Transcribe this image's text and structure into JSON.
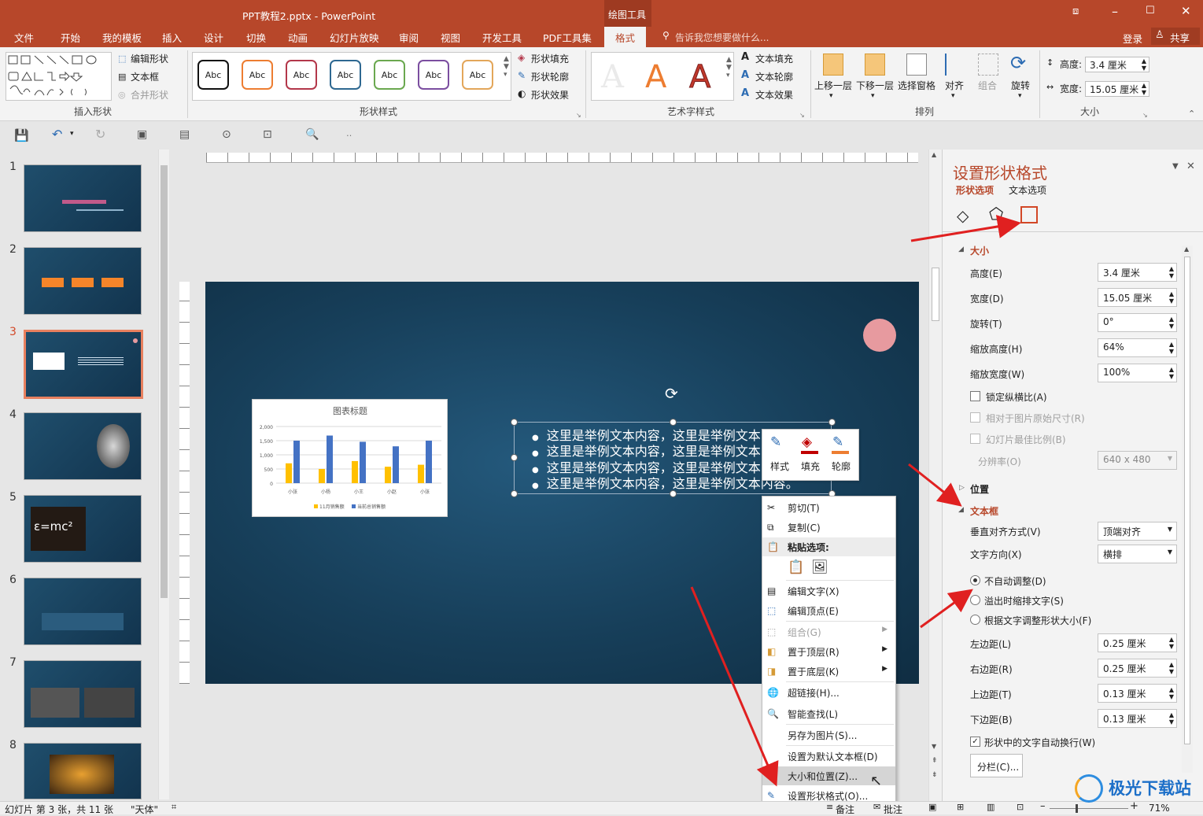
{
  "window": {
    "title": "PPT教程2.pptx - PowerPoint",
    "context_tab": "绘图工具"
  },
  "tabs": [
    "文件",
    "开始",
    "我的模板",
    "插入",
    "设计",
    "切换",
    "动画",
    "幻灯片放映",
    "审阅",
    "视图",
    "开发工具",
    "PDF工具集",
    "格式"
  ],
  "tell_me": "告诉我您想要做什么...",
  "account": {
    "login": "登录",
    "share": "共享"
  },
  "ribbon": {
    "insert_shapes": {
      "edit_shape": "编辑形状",
      "text_box": "文本框",
      "merge_shapes": "合并形状",
      "label": "插入形状"
    },
    "shape_styles": {
      "sample": "Abc",
      "fill": "形状填充",
      "outline": "形状轮廓",
      "effects": "形状效果",
      "label": "形状样式"
    },
    "wordart": {
      "text_fill": "文本填充",
      "text_outline": "文本轮廓",
      "text_effects": "文本效果",
      "label": "艺术字样式"
    },
    "arrange": {
      "bring_forward": "上移一层",
      "send_backward": "下移一层",
      "selection_pane": "选择窗格",
      "align": "对齐",
      "group": "组合",
      "rotate": "旋转",
      "label": "排列"
    },
    "size": {
      "height_label": "高度:",
      "height_value": "3.4 厘米",
      "width_label": "宽度:",
      "width_value": "15.05 厘米",
      "label": "大小"
    }
  },
  "slides": [
    "1",
    "2",
    "3",
    "4",
    "5",
    "6",
    "7",
    "8"
  ],
  "slide_content": {
    "chart_title": "图表标题",
    "bullets": [
      "这里是举例文本内容，这里是举例文本内容。",
      "这里是举例文本内容，这里是举例文本内容。",
      "这里是举例文本内容，这里是举例文本内容。",
      "这里是举例文本内容，这里是举例文本内容。"
    ]
  },
  "chart_data": {
    "type": "bar",
    "title": "图表标题",
    "categories": [
      "小张",
      "小杨",
      "小王",
      "小赵",
      "小张"
    ],
    "series": [
      {
        "name": "11月销售额",
        "color": "#ffc000",
        "values": [
          700,
          500,
          780,
          580,
          650
        ]
      },
      {
        "name": "当前总销售额",
        "color": "#4472c4",
        "values": [
          1500,
          1680,
          1460,
          1300,
          1500
        ]
      }
    ],
    "yticks": [
      "2,000",
      "1,500",
      "1,000",
      "500",
      "0"
    ],
    "ylim": [
      0,
      2000
    ]
  },
  "mini_toolbar": {
    "style": "样式",
    "fill": "填充",
    "outline": "轮廓"
  },
  "context_menu": {
    "cut": "剪切(T)",
    "copy": "复制(C)",
    "paste_options": "粘贴选项:",
    "edit_text": "编辑文字(X)",
    "edit_points": "编辑顶点(E)",
    "group": "组合(G)",
    "bring_to_front": "置于顶层(R)",
    "send_to_back": "置于底层(K)",
    "hyperlink": "超链接(H)...",
    "smart_lookup": "智能查找(L)",
    "save_as_picture": "另存为图片(S)...",
    "set_default": "设置为默认文本框(D)",
    "size_position": "大小和位置(Z)...",
    "format_shape": "设置形状格式(O)..."
  },
  "format_pane": {
    "title": "设置形状格式",
    "tab_shape": "形状选项",
    "tab_text": "文本选项",
    "size_section": "大小",
    "height": {
      "label": "高度(E)",
      "value": "3.4 厘米"
    },
    "width": {
      "label": "宽度(D)",
      "value": "15.05 厘米"
    },
    "rotation": {
      "label": "旋转(T)",
      "value": "0°"
    },
    "scale_height": {
      "label": "缩放高度(H)",
      "value": "64%"
    },
    "scale_width": {
      "label": "缩放宽度(W)",
      "value": "100%"
    },
    "lock_aspect": "锁定纵横比(A)",
    "relative_original": "相对于图片原始尺寸(R)",
    "best_scale": "幻灯片最佳比例(B)",
    "resolution": {
      "label": "分辨率(O)",
      "value": "640 x 480"
    },
    "position_section": "位置",
    "textbox_section": "文本框",
    "vertical_align": {
      "label": "垂直对齐方式(V)",
      "value": "顶端对齐"
    },
    "text_direction": {
      "label": "文字方向(X)",
      "value": "横排"
    },
    "autofit_none": "不自动调整(D)",
    "autofit_shrink": "溢出时缩排文字(S)",
    "autofit_resize": "根据文字调整形状大小(F)",
    "left_margin": {
      "label": "左边距(L)",
      "value": "0.25 厘米"
    },
    "right_margin": {
      "label": "右边距(R)",
      "value": "0.25 厘米"
    },
    "top_margin": {
      "label": "上边距(T)",
      "value": "0.13 厘米"
    },
    "bottom_margin": {
      "label": "下边距(B)",
      "value": "0.13 厘米"
    },
    "wrap_text": "形状中的文字自动换行(W)",
    "columns": "分栏(C)..."
  },
  "status": {
    "slide_info": "幻灯片 第 3 张，共 11 张",
    "theme": "\"天体\"",
    "notes": "备注",
    "comments": "批注",
    "zoom": "71%"
  },
  "watermark": "极光下载站"
}
